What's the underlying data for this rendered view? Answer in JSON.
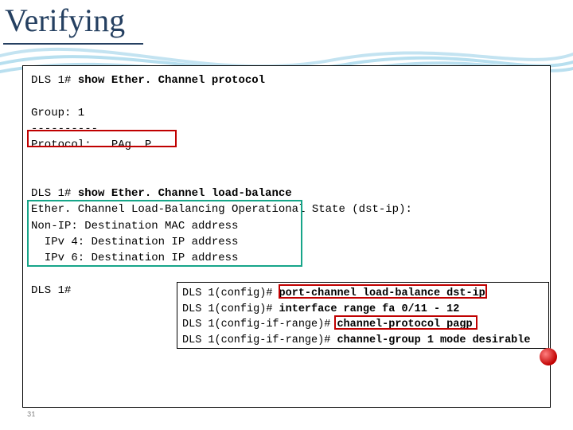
{
  "title": "Verifying",
  "page_number": "31",
  "lines": {
    "l1_prompt": "DLS 1# ",
    "l1_cmd": "show Ether. Channel protocol",
    "l3": "Group: 1",
    "l4": "----------",
    "l5": "Protocol:   PAg. P",
    "l8_prompt": "DLS 1# ",
    "l8_cmd": "show Ether. Channel load-balance",
    "l9": "Ether. Channel Load-Balancing Operational State (dst-ip):",
    "l10": "Non-IP: Destination MAC address",
    "l11": "  IPv 4: Destination IP address",
    "l12": "  IPv 6: Destination IP address",
    "l14": "DLS 1#"
  },
  "config": {
    "c1_prompt": "DLS 1(config)# ",
    "c1_cmd": "port-channel load-balance dst-ip",
    "c2_prompt": "DLS 1(config)# ",
    "c2_cmd": "interface range fa 0/11 - 12",
    "c3_prompt": "DLS 1(config-if-range)# ",
    "c3_cmd": "channel-protocol pagp",
    "c4_prompt": "DLS 1(config-if-range)# ",
    "c4_cmd": "channel-group 1 mode desirable"
  }
}
